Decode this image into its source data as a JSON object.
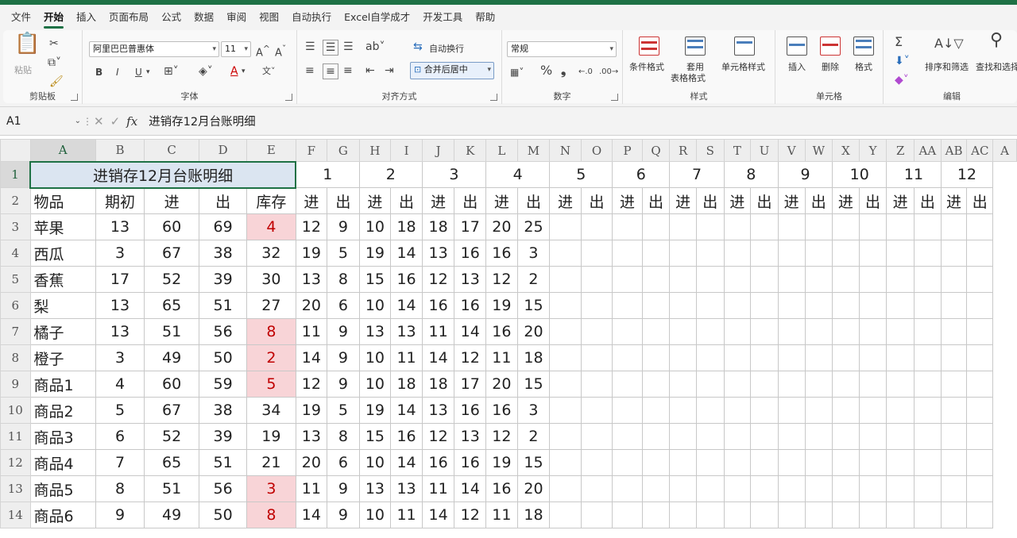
{
  "menu": [
    "文件",
    "开始",
    "插入",
    "页面布局",
    "公式",
    "数据",
    "审阅",
    "视图",
    "自动执行",
    "Excel自学成才",
    "开发工具",
    "帮助"
  ],
  "menu_active": "开始",
  "ribbon": {
    "clipboard": {
      "label": "剪贴板",
      "paste": "粘贴"
    },
    "font": {
      "label": "字体",
      "name": "阿里巴巴普惠体",
      "size": "11",
      "bold": "B",
      "italic": "I",
      "underline": "U",
      "grow": "A^",
      "shrink": "A˅",
      "font_color": "A"
    },
    "align": {
      "label": "对齐方式",
      "wrap": "自动换行",
      "merge": "合并后居中"
    },
    "number": {
      "label": "数字",
      "format": "常规",
      "percent": "%",
      "comma": "❟"
    },
    "styles": {
      "label": "样式",
      "cond": "条件格式",
      "table_a": "套用",
      "table_b": "表格格式",
      "cell_style": "单元格样式"
    },
    "cells": {
      "label": "单元格",
      "insert": "插入",
      "delete": "删除",
      "format": "格式"
    },
    "edit": {
      "label": "编辑",
      "sort": "排序和筛选",
      "find": "查找和选择",
      "sigma": "Σ"
    }
  },
  "formula_bar": {
    "name_box": "A1",
    "fx": "fx",
    "content": "进销存12月台账明细"
  },
  "columns": [
    "A",
    "B",
    "C",
    "D",
    "E",
    "F",
    "G",
    "H",
    "I",
    "J",
    "K",
    "L",
    "M",
    "N",
    "O",
    "P",
    "Q",
    "R",
    "S",
    "T",
    "U",
    "V",
    "W",
    "X",
    "Y",
    "Z",
    "AA",
    "AB",
    "AC",
    "A"
  ],
  "sheet": {
    "title": "进销存12月台账明细",
    "months": [
      "1",
      "2",
      "3",
      "4",
      "5",
      "6",
      "7",
      "8",
      "9",
      "10",
      "11",
      "12"
    ],
    "header_row": [
      "物品",
      "期初",
      "进",
      "出",
      "库存"
    ],
    "in_label": "进",
    "out_label": "出",
    "rows": [
      {
        "name": "苹果",
        "start": "13",
        "in": "60",
        "out": "69",
        "stock": "4",
        "neg": true,
        "daily": [
          "12",
          "9",
          "10",
          "18",
          "18",
          "17",
          "20",
          "25"
        ]
      },
      {
        "name": "西瓜",
        "start": "3",
        "in": "67",
        "out": "38",
        "stock": "32",
        "neg": false,
        "daily": [
          "19",
          "5",
          "19",
          "14",
          "13",
          "16",
          "16",
          "3"
        ]
      },
      {
        "name": "香蕉",
        "start": "17",
        "in": "52",
        "out": "39",
        "stock": "30",
        "neg": false,
        "daily": [
          "13",
          "8",
          "15",
          "16",
          "12",
          "13",
          "12",
          "2"
        ]
      },
      {
        "name": "梨",
        "start": "13",
        "in": "65",
        "out": "51",
        "stock": "27",
        "neg": false,
        "daily": [
          "20",
          "6",
          "10",
          "14",
          "16",
          "16",
          "19",
          "15"
        ]
      },
      {
        "name": "橘子",
        "start": "13",
        "in": "51",
        "out": "56",
        "stock": "8",
        "neg": true,
        "daily": [
          "11",
          "9",
          "13",
          "13",
          "11",
          "14",
          "16",
          "20"
        ]
      },
      {
        "name": "橙子",
        "start": "3",
        "in": "49",
        "out": "50",
        "stock": "2",
        "neg": true,
        "daily": [
          "14",
          "9",
          "10",
          "11",
          "14",
          "12",
          "11",
          "18"
        ]
      },
      {
        "name": "商品1",
        "start": "4",
        "in": "60",
        "out": "59",
        "stock": "5",
        "neg": true,
        "daily": [
          "12",
          "9",
          "10",
          "18",
          "18",
          "17",
          "20",
          "15"
        ]
      },
      {
        "name": "商品2",
        "start": "5",
        "in": "67",
        "out": "38",
        "stock": "34",
        "neg": false,
        "daily": [
          "19",
          "5",
          "19",
          "14",
          "13",
          "16",
          "16",
          "3"
        ]
      },
      {
        "name": "商品3",
        "start": "6",
        "in": "52",
        "out": "39",
        "stock": "19",
        "neg": false,
        "daily": [
          "13",
          "8",
          "15",
          "16",
          "12",
          "13",
          "12",
          "2"
        ]
      },
      {
        "name": "商品4",
        "start": "7",
        "in": "65",
        "out": "51",
        "stock": "21",
        "neg": false,
        "daily": [
          "20",
          "6",
          "10",
          "14",
          "16",
          "16",
          "19",
          "15"
        ]
      },
      {
        "name": "商品5",
        "start": "8",
        "in": "51",
        "out": "56",
        "stock": "3",
        "neg": true,
        "daily": [
          "11",
          "9",
          "13",
          "13",
          "11",
          "14",
          "16",
          "20"
        ]
      },
      {
        "name": "商品6",
        "start": "9",
        "in": "49",
        "out": "50",
        "stock": "8",
        "neg": true,
        "daily": [
          "14",
          "9",
          "10",
          "11",
          "14",
          "12",
          "11",
          "18"
        ]
      }
    ]
  },
  "colors": {
    "accent": "#1e7145",
    "title_fill": "#dbe5f1",
    "low_stock_fill": "#f8d4d7",
    "low_stock_text": "#c00000"
  }
}
